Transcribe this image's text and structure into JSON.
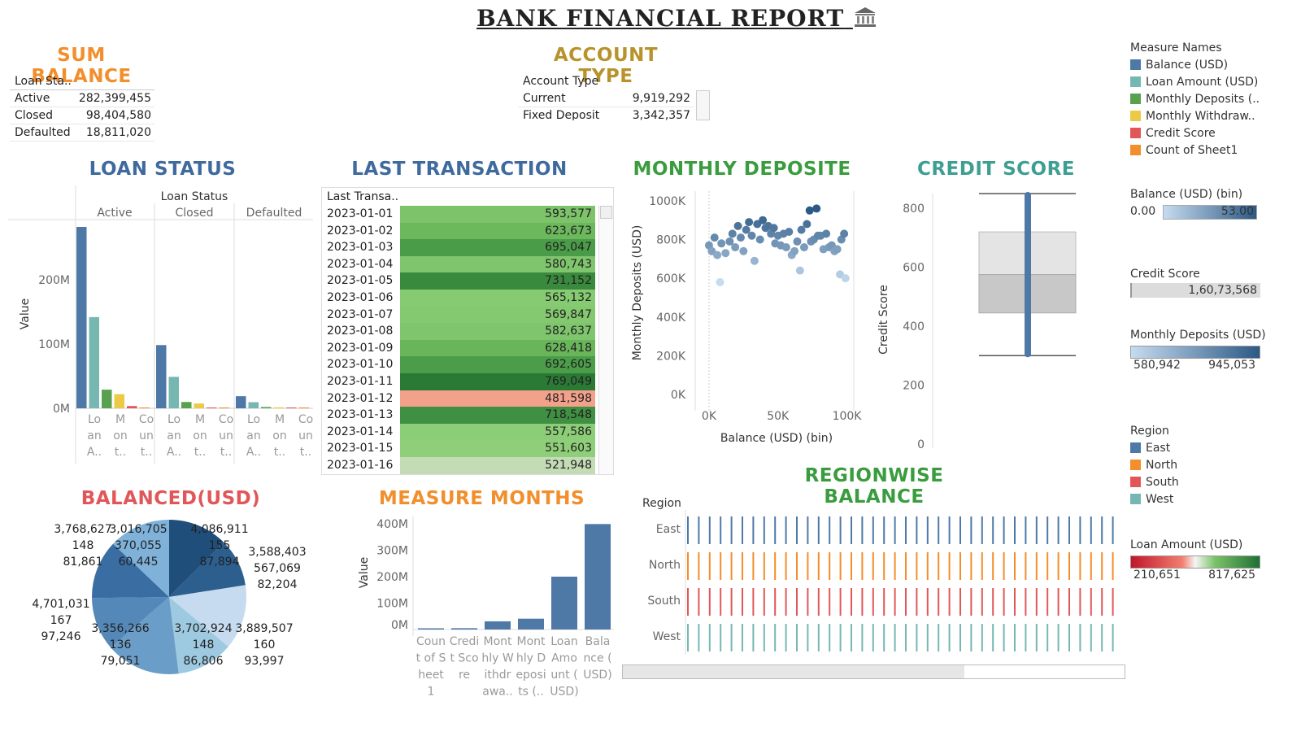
{
  "header": {
    "title": "BANK FINANCIAL REPORT",
    "icon": "bank-icon"
  },
  "colors": {
    "balance": "#4e79a7",
    "loan": "#76b7b2",
    "deposits": "#59a14f",
    "withdraw": "#edc948",
    "credit": "#e15759",
    "count": "#f28e2b",
    "east": "#4e79a7",
    "north": "#f28e2b",
    "south": "#e15759",
    "west": "#76b7b2"
  },
  "sum_balance": {
    "title": "SUM BALANCE",
    "header": "Loan Sta..",
    "rows": [
      {
        "label": "Active",
        "value": "282,399,455"
      },
      {
        "label": "Closed",
        "value": "98,404,580"
      },
      {
        "label": "Defaulted",
        "value": "18,811,020"
      }
    ]
  },
  "account_type": {
    "title": "ACCOUNT TYPE",
    "header": "Account Type",
    "rows": [
      {
        "label": "Current",
        "value": "9,919,292"
      },
      {
        "label": "Fixed Deposit",
        "value": "3,342,357"
      }
    ]
  },
  "legend_measures": {
    "title": "Measure Names",
    "items": [
      {
        "label": "Balance (USD)",
        "color": "#4e79a7"
      },
      {
        "label": "Loan Amount (USD)",
        "color": "#76b7b2"
      },
      {
        "label": "Monthly Deposits (..",
        "color": "#59a14f"
      },
      {
        "label": "Monthly Withdraw..",
        "color": "#edc948"
      },
      {
        "label": "Credit Score",
        "color": "#e15759"
      },
      {
        "label": "Count of Sheet1",
        "color": "#f28e2b"
      }
    ]
  },
  "legend_balance_bin": {
    "title": "Balance (USD) (bin)",
    "min": "0.00",
    "max": "53.00"
  },
  "legend_credit": {
    "title": "Credit Score",
    "value": "1,60,73,568"
  },
  "legend_deposits": {
    "title": "Monthly Deposits (USD)",
    "min": "580,942",
    "max": "945,053"
  },
  "legend_region": {
    "title": "Region",
    "items": [
      {
        "label": "East",
        "color": "#4e79a7"
      },
      {
        "label": "North",
        "color": "#f28e2b"
      },
      {
        "label": "South",
        "color": "#e15759"
      },
      {
        "label": "West",
        "color": "#76b7b2"
      }
    ]
  },
  "legend_loan": {
    "title": "Loan Amount (USD)",
    "min": "210,651",
    "max": "817,625"
  },
  "loan_status": {
    "title": "LOAN STATUS",
    "panel_header": "Loan Status",
    "y_label": "Value",
    "y_ticks": [
      "0M",
      "100M",
      "200M"
    ],
    "groups": [
      "Active",
      "Closed",
      "Defaulted"
    ],
    "x_ticks": [
      [
        "Lo",
        "an",
        "A.."
      ],
      [
        "M",
        "on",
        "t.."
      ],
      [
        "Co",
        "un",
        "t.."
      ]
    ]
  },
  "last_transaction": {
    "title": "LAST TRANSACTION",
    "header": "Last Transa..",
    "rows": [
      {
        "date": "2023-01-01",
        "value": "593,577",
        "color": "#7cc36a"
      },
      {
        "date": "2023-01-02",
        "value": "623,673",
        "color": "#6cb85d"
      },
      {
        "date": "2023-01-03",
        "value": "695,047",
        "color": "#4a9c48"
      },
      {
        "date": "2023-01-04",
        "value": "580,743",
        "color": "#7fc56d"
      },
      {
        "date": "2023-01-05",
        "value": "731,152",
        "color": "#3a8a3e"
      },
      {
        "date": "2023-01-06",
        "value": "565,132",
        "color": "#86ca72"
      },
      {
        "date": "2023-01-07",
        "value": "569,847",
        "color": "#84c870"
      },
      {
        "date": "2023-01-08",
        "value": "582,637",
        "color": "#7fc56d"
      },
      {
        "date": "2023-01-09",
        "value": "628,418",
        "color": "#68b55a"
      },
      {
        "date": "2023-01-10",
        "value": "692,605",
        "color": "#4b9d49"
      },
      {
        "date": "2023-01-11",
        "value": "769,049",
        "color": "#2a7a35"
      },
      {
        "date": "2023-01-12",
        "value": "481,598",
        "color": "#f4a18c"
      },
      {
        "date": "2023-01-13",
        "value": "718,548",
        "color": "#3f9042"
      },
      {
        "date": "2023-01-14",
        "value": "557,586",
        "color": "#8ccd77"
      },
      {
        "date": "2023-01-15",
        "value": "551,603",
        "color": "#90cf7a"
      },
      {
        "date": "2023-01-16",
        "value": "521,948",
        "color": "#c4dcb6"
      }
    ]
  },
  "monthly_deposit": {
    "title": "MONTHLY DEPOSITE",
    "x_label": "Balance (USD) (bin)",
    "y_label": "Monthly Deposits (USD)",
    "x_ticks": [
      "0K",
      "50K",
      "100K"
    ],
    "y_ticks": [
      "0K",
      "200K",
      "400K",
      "600K",
      "800K",
      "1000K"
    ]
  },
  "credit_score": {
    "title": "CREDIT SCORE",
    "y_label": "Credit Score",
    "y_ticks": [
      "0",
      "200",
      "400",
      "600",
      "800"
    ]
  },
  "balanced": {
    "title": "BALANCED(USD)",
    "labels": [
      {
        "lines": [
          "3,768,627",
          "148",
          "81,861"
        ]
      },
      {
        "lines": [
          "3,016,705",
          "370,055",
          "60,445"
        ]
      },
      {
        "lines": [
          "4,086,911",
          "155",
          "87,894"
        ]
      },
      {
        "lines": [
          "3,588,403",
          "567,069",
          "82,204"
        ]
      },
      {
        "lines": [
          "4,701,031",
          "167",
          "97,246"
        ]
      },
      {
        "lines": [
          "3,356,266",
          "136",
          "79,051"
        ]
      },
      {
        "lines": [
          "3,702,924",
          "148",
          "86,806"
        ]
      },
      {
        "lines": [
          "3,889,507",
          "160",
          "93,997"
        ]
      }
    ]
  },
  "measure_months": {
    "title": "MEASURE MONTHS",
    "y_label": "Value",
    "y_ticks": [
      "0M",
      "100M",
      "200M",
      "300M",
      "400M"
    ],
    "categories": [
      [
        "Coun",
        "t of S",
        "heet",
        "1"
      ],
      [
        "Credi",
        "t Sco",
        "re"
      ],
      [
        "Mont",
        "hly W",
        "ithdr",
        "awa.."
      ],
      [
        "Mont",
        "hly D",
        "eposi",
        "ts (.."
      ],
      [
        "Loan",
        "Amo",
        "unt (",
        "USD)"
      ],
      [
        "Bala",
        "nce (",
        "USD)"
      ]
    ]
  },
  "regionwise": {
    "title": "REGIONWISE BALANCE",
    "header": "Region",
    "regions": [
      "East",
      "North",
      "South",
      "West"
    ]
  },
  "chart_data": [
    {
      "type": "bar",
      "name": "loan_status",
      "title": "LOAN STATUS",
      "ylabel": "Value",
      "ylim": [
        0,
        290000000
      ],
      "categories": [
        "Active",
        "Closed",
        "Defaulted"
      ],
      "series": [
        {
          "name": "Balance (USD)",
          "values": [
            282399455,
            98404580,
            18811020
          ]
        },
        {
          "name": "Loan Amount (USD)",
          "values": [
            142000000,
            49000000,
            9500000
          ]
        },
        {
          "name": "Monthly Deposits (USD)",
          "values": [
            29000000,
            9800000,
            2000000
          ]
        },
        {
          "name": "Monthly Withdrawals (USD)",
          "values": [
            22000000,
            7500000,
            1500000
          ]
        },
        {
          "name": "Credit Score",
          "values": [
            3500000,
            1200000,
            250000
          ]
        },
        {
          "name": "Count of Sheet1",
          "values": [
            100000,
            40000,
            8000
          ]
        }
      ]
    },
    {
      "type": "table",
      "name": "last_transaction",
      "x": [
        "2023-01-01",
        "2023-01-02",
        "2023-01-03",
        "2023-01-04",
        "2023-01-05",
        "2023-01-06",
        "2023-01-07",
        "2023-01-08",
        "2023-01-09",
        "2023-01-10",
        "2023-01-11",
        "2023-01-12",
        "2023-01-13",
        "2023-01-14",
        "2023-01-15",
        "2023-01-16"
      ],
      "values": [
        593577,
        623673,
        695047,
        580743,
        731152,
        565132,
        569847,
        582637,
        628418,
        692605,
        769049,
        481598,
        718548,
        557586,
        551603,
        521948
      ]
    },
    {
      "type": "scatter",
      "name": "monthly_deposit",
      "title": "MONTHLY DEPOSITE",
      "xlabel": "Balance (USD) (bin)",
      "ylabel": "Monthly Deposits (USD)",
      "xlim": [
        -10000,
        105000
      ],
      "ylim": [
        0,
        1050000
      ],
      "points": [
        [
          0,
          770000
        ],
        [
          2000,
          740000
        ],
        [
          4000,
          810000
        ],
        [
          6000,
          720000
        ],
        [
          8000,
          580000
        ],
        [
          9000,
          780000
        ],
        [
          12000,
          730000
        ],
        [
          15000,
          790000
        ],
        [
          17000,
          830000
        ],
        [
          19000,
          760000
        ],
        [
          21000,
          870000
        ],
        [
          23000,
          810000
        ],
        [
          25000,
          740000
        ],
        [
          27000,
          850000
        ],
        [
          29000,
          890000
        ],
        [
          31000,
          820000
        ],
        [
          33000,
          690000
        ],
        [
          35000,
          880000
        ],
        [
          37000,
          800000
        ],
        [
          39000,
          900000
        ],
        [
          41000,
          860000
        ],
        [
          43000,
          870000
        ],
        [
          45000,
          830000
        ],
        [
          47000,
          860000
        ],
        [
          48000,
          780000
        ],
        [
          50000,
          820000
        ],
        [
          52000,
          770000
        ],
        [
          54000,
          830000
        ],
        [
          56000,
          760000
        ],
        [
          58000,
          840000
        ],
        [
          60000,
          720000
        ],
        [
          62000,
          740000
        ],
        [
          64000,
          790000
        ],
        [
          66000,
          640000
        ],
        [
          67000,
          850000
        ],
        [
          69000,
          760000
        ],
        [
          71000,
          880000
        ],
        [
          73000,
          950000
        ],
        [
          74000,
          790000
        ],
        [
          76000,
          800000
        ],
        [
          78000,
          960000
        ],
        [
          79000,
          820000
        ],
        [
          81000,
          820000
        ],
        [
          83000,
          750000
        ],
        [
          85000,
          830000
        ],
        [
          87000,
          760000
        ],
        [
          89000,
          770000
        ],
        [
          91000,
          740000
        ],
        [
          93000,
          750000
        ],
        [
          95000,
          620000
        ],
        [
          96000,
          800000
        ],
        [
          98000,
          830000
        ],
        [
          99000,
          600000
        ]
      ]
    },
    {
      "type": "box",
      "name": "credit_score",
      "title": "CREDIT SCORE",
      "ylabel": "Credit Score",
      "ylim": [
        0,
        850
      ],
      "min": 300,
      "q1": 445,
      "median": 575,
      "q3": 720,
      "max": 850
    },
    {
      "type": "pie",
      "name": "balanced",
      "title": "BALANCED(USD)",
      "categories": [
        "3,768,627",
        "3,016,705",
        "4,086,911",
        "3,588,403",
        "4,701,031",
        "3,356,266",
        "3,702,924",
        "3,889,507"
      ],
      "values": [
        3768627,
        3016705,
        4086911,
        3588403,
        4701031,
        3356266,
        3702924,
        3889507
      ]
    },
    {
      "type": "bar",
      "name": "measure_months",
      "title": "MEASURE MONTHS",
      "ylabel": "Value",
      "ylim": [
        -70000000,
        420000000
      ],
      "categories": [
        "Count of Sheet1",
        "Credit Score",
        "Monthly Withdrawals",
        "Monthly Deposits (USD)",
        "Loan Amount (USD)",
        "Balance (USD)"
      ],
      "values": [
        150000,
        5000000,
        31000000,
        41000000,
        200000000,
        399000000
      ]
    }
  ]
}
